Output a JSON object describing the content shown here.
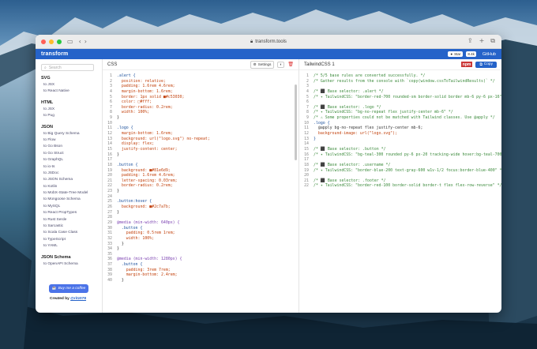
{
  "browser": {
    "url": "transform.tools"
  },
  "app": {
    "brand": "transform",
    "star_label": "Star",
    "star_count": "8.4k",
    "github_label": "GitHub"
  },
  "sidebar": {
    "search_placeholder": "Search",
    "sections": [
      {
        "title": "SVG",
        "items": [
          "to JSX",
          "to React Native"
        ]
      },
      {
        "title": "HTML",
        "items": [
          "to JSX",
          "to Pug"
        ]
      },
      {
        "title": "JSON",
        "items": [
          "to Big Query Schema",
          "to Flow",
          "to Go Bson",
          "to Go Struct",
          "to GraphQL",
          "to io-ts",
          "to JSDoc",
          "to JSON Schema",
          "to Kotlin",
          "to MobX-State-Tree Model",
          "to Mongoose Schema",
          "to MySQL",
          "to React PropTypes",
          "to Rust Serde",
          "to Sarcastic",
          "to Scala Case Class",
          "to TypeScript",
          "to YAML"
        ]
      },
      {
        "title": "JSON Schema",
        "items": [
          "to OpenAPI Schema"
        ]
      }
    ],
    "coffee_label": "Buy me a coffee",
    "created_prefix": "Created by",
    "created_author": "@ritz078"
  },
  "css_pane": {
    "title": "CSS",
    "settings_label": "Settings",
    "lines": [
      ".alert {",
      "  position: relative;",
      "  padding: 1.6rem 4.6rem;",
      "  margin-bottom: 1.6rem;",
      "  border: 1px solid ■#c53030;",
      "  color: □#fff;",
      "  border-radius: 0.2rem;",
      "  width: 100%;",
      "}",
      "",
      ".logo {",
      "  margin-bottom: 1.6rem;",
      "  background: url(\"logo.svg\") no-repeat;",
      "  display: flex;",
      "  justify-content: center;",
      "}",
      "",
      ".button {",
      "  background: ■#81e6d9;",
      "  padding: 1.6rem 4.6rem;",
      "  letter-spacing: 0.03rem;",
      "  border-radius: 0.2rem;",
      "}",
      "",
      ".button:hover {",
      "  background: ■#2c7a7b;",
      "}",
      "",
      "@media (min-width: 640px) {",
      "  .button {",
      "    padding: 0.5rem 1rem;",
      "    width: 100%;",
      "  }",
      "}",
      "",
      "@media (min-width: 1280px) {",
      "  .button {",
      "    padding: 3rem 7rem;",
      "    margin-bottom: 2.4rem;",
      "  }"
    ]
  },
  "tw_pane": {
    "title": "TailwindCSS 1",
    "npm_label": "npm",
    "copy_label": "Copy",
    "lines": [
      "/* 5/5 base rules are converted successfully. */",
      "/* Gather results from the console with `copy(window.cssToTailwindResults)` */",
      "",
      "/* ⬛ Base selector: .alert */",
      "/* ✦ TailwindCSS: \"border-red-700 rounded-sm border-solid border mb-6 py-6 px-16\" */",
      "",
      "/* ⬛ Base selector: .logo */",
      "/* ✦ TailwindCSS: \"bg-no-repeat flex justify-center mb-6\" */",
      "/* ⚠ Some properties could not be matched with Tailwind classes. Use @apply */",
      ".logo {",
      "  @apply bg-no-repeat flex justify-center mb-6;",
      "  background-image: url(\"logo.svg\");",
      "}",
      "",
      "/* ⬛ Base selector: .button */",
      "/* ✦ TailwindCSS: \"bg-teal-300 rounded py-6 px-20 tracking-wide hover:bg-teal-700\" */",
      "",
      "/* ⬛ Base selector: .username */",
      "/* ✦ TailwindCSS: \"border-blue-200 text-gray-600 w1v-1/2 focus:border-blue-400\" */",
      "",
      "/* ⬛ Base selector: .footer */",
      "/* ✦ TailwindCSS: \"border-red-100 border-solid border-t flex flex-row-reverse\" */"
    ]
  }
}
